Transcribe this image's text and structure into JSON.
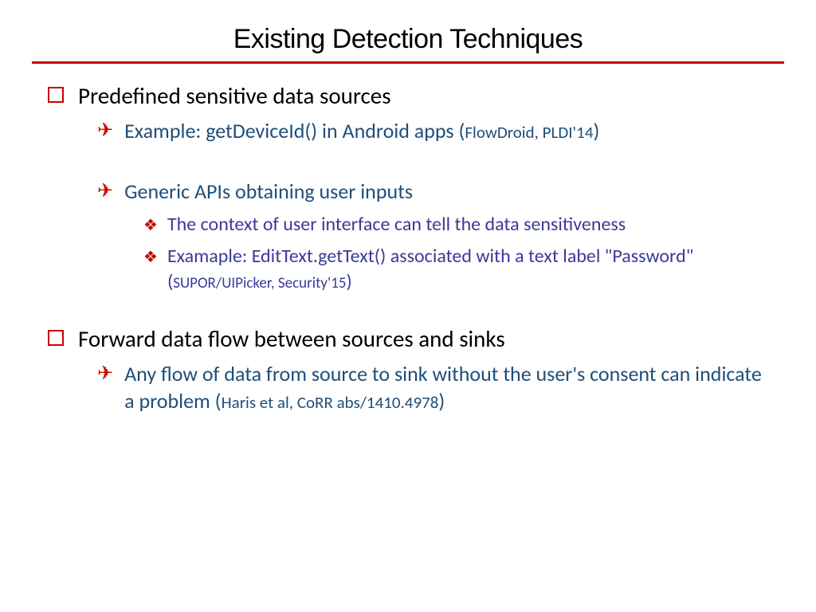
{
  "title": "Existing Detection Techniques",
  "items": {
    "main1": "Predefined sensitive data sources",
    "sub1a_text": "Example: getDeviceId() in Android apps (",
    "sub1a_cite": "FlowDroid, PLDI'14",
    "sub1a_close": ")",
    "sub1b": "Generic APIs obtaining user inputs",
    "sub1b_i": "The context of user interface can tell the data sensitiveness",
    "sub1b_ii_text": "Examaple: EditText.getText() associated with a text label \"Password\" (",
    "sub1b_ii_cite": "SUPOR/UIPicker, Security'15",
    "sub1b_ii_close": ")",
    "main2": "Forward data flow between sources and sinks",
    "sub2a_text": "Any flow of data from source to sink without the user's consent can indicate a problem (",
    "sub2a_cite": "Haris et al, CoRR abs/1410.4978",
    "sub2a_close": ")"
  }
}
